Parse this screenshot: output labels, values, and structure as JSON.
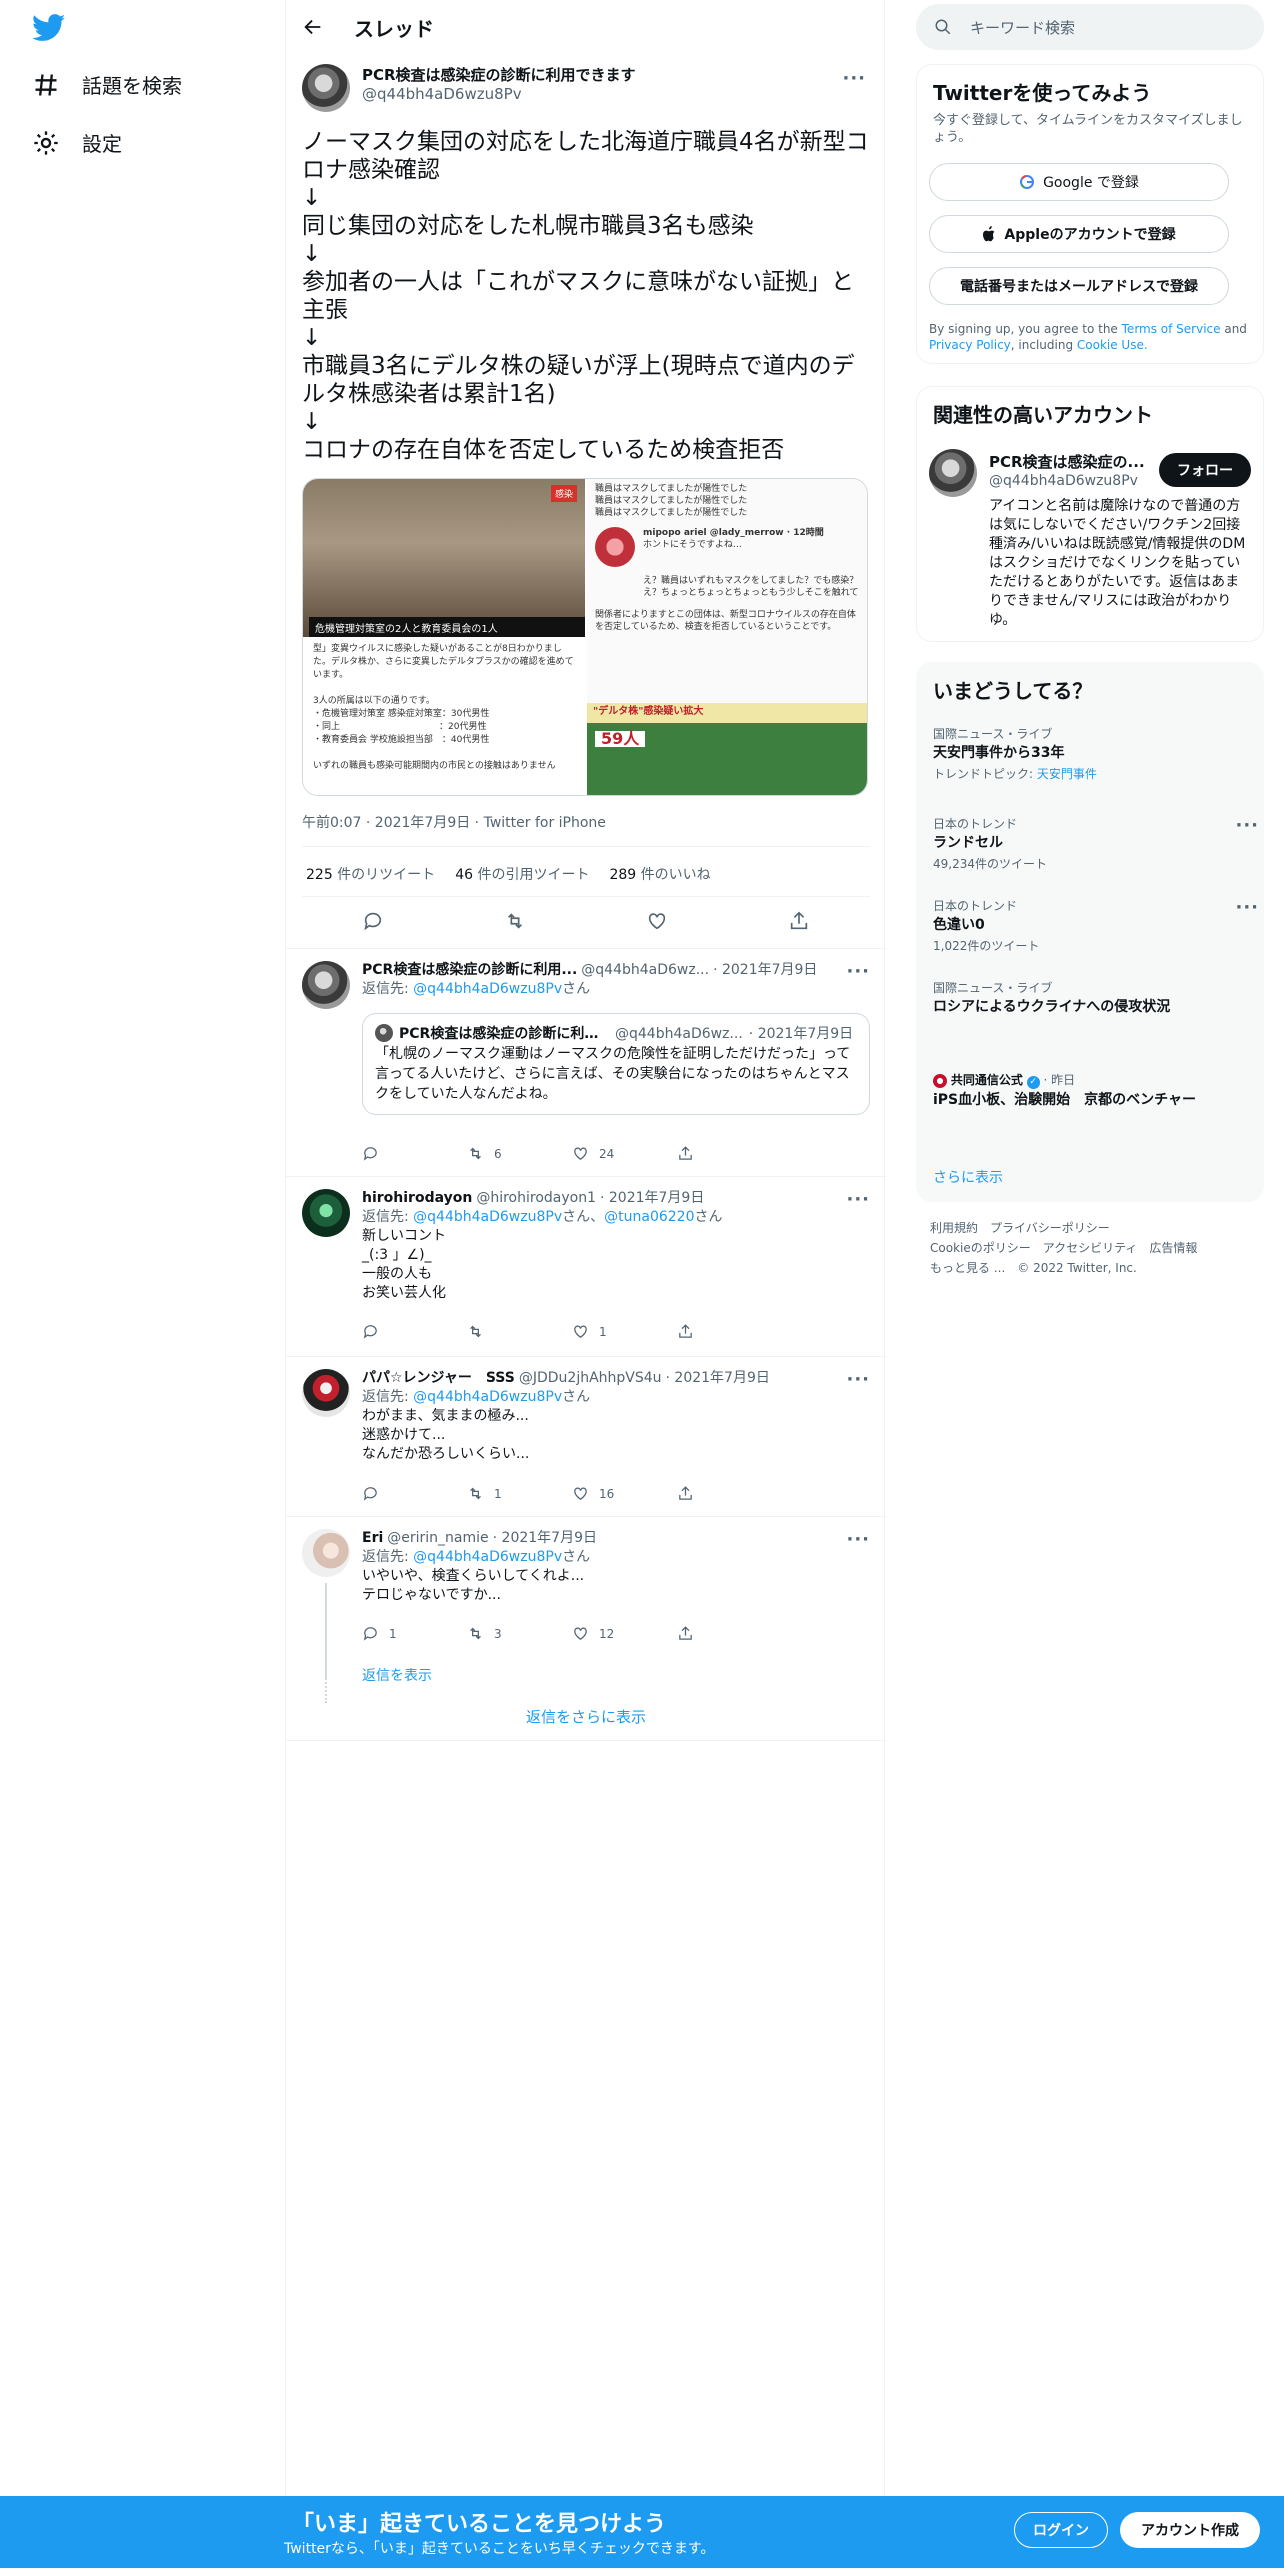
{
  "nav": {
    "explore_label": "話題を検索",
    "settings_label": "設定"
  },
  "header": {
    "title": "スレッド"
  },
  "tweet": {
    "author_name": "PCR検査は感染症の診断に利用できます",
    "author_handle": "@q44bh4aD6wzu8Pv",
    "text": "ノーマスク集団の対応をした北海道庁職員4名が新型コロナ感染確認\n↓\n同じ集団の対応をした札幌市職員3名も感染\n↓\n参加者の一人は「これがマスクに意味がない証拠」と主張\n↓\n市職員3名にデルタ株の疑いが浮上(現時点で道内のデルタ株感染者は累計1名)\n↓\nコロナの存在自体を否定しているため検査拒否",
    "media": {
      "img1_banner": "危機管理対策室の2人と教育委員会の1人",
      "img1_tag": "感染",
      "img1_body": "型」変異ウイルスに感染した疑いがあることが8日わかりました。デルタ株か、さらに変異したデルタプラスかの確認を進めています。\n\n3人の所属は以下の通りです。\n・危機管理対策室 感染症対策室：30代男性\n・同上　　　　　　　　　　　：20代男性\n・教育委員会 学校施設担当部　：40代男性\n\nいずれの職員も感染可能期間内の市民との接触はありません",
      "img2_top": "職員はマスクしてましたが陽性でした\n職員はマスクしてましたが陽性でした\n職員はマスクしてましたが陽性でした",
      "img2_user": "mipopo ariel @lady_merrow · 12時間",
      "img2_reply": "ホントにそうですよね…",
      "img2_mid": "え？職員はいずれもマスクをしてました？でも感染？え？ちょっとちょっとちょっともう少しそこを触れて",
      "img2_bottom": "関係者によりますとこの団体は、新型コロナウイルスの存在自体を否定しているため、検査を拒否しているということです。",
      "img2_chart_header": "\"デルタ株\"感染疑い拡大",
      "img2_chart_num": "59人"
    },
    "time": "午前0:07 · 2021年7月9日 · Twitter for iPhone",
    "retweets": "225",
    "retweets_label": "件のリツイート",
    "quotes": "46",
    "quotes_label": "件の引用ツイート",
    "likes": "289",
    "likes_label": "件のいいね"
  },
  "replies": [
    {
      "name": "PCR検査は感染症の診断に利用...",
      "handle": "@q44bh4aD6wz...",
      "date": "· 2021年7月9日",
      "reply_to_prefix": "返信先: ",
      "reply_to": "@q44bh4aD6wzu8Pv",
      "reply_to_suffix": "さん",
      "quote": {
        "name": "PCR検査は感染症の診断に利用...",
        "handle": "@q44bh4aD6wz...",
        "date": "· 2021年7月9日",
        "text": "「札幌のノーマスク運動はノーマスクの危険性を証明しただけだった」って言ってる人いたけど、さらに言えば、その実験台になったのはちゃんとマスクをしていた人なんだよね。"
      },
      "retweets": "6",
      "likes": "24"
    },
    {
      "name": "hirohirodayon",
      "handle": "@hirohirodayon1",
      "date": "· 2021年7月9日",
      "reply_to_prefix": "返信先: ",
      "reply_to": "@q44bh4aD6wzu8Pv",
      "reply_to_mid": "さん、",
      "reply_to2": "@tuna06220",
      "reply_to_suffix": "さん",
      "text": "新しいコント\n_(:3 」∠)_\n一般の人も\nお笑い芸人化",
      "retweets": "",
      "likes": "1"
    },
    {
      "name": "パパ☆レンジャー　SSS",
      "handle": "@JDDu2jhAhhpVS4u",
      "date": "· 2021年7月9日",
      "reply_to_prefix": "返信先: ",
      "reply_to": "@q44bh4aD6wzu8Pv",
      "reply_to_suffix": "さん",
      "text": "わがまま、気ままの極み...\n迷惑かけて...\nなんだか恐ろしいくらい...",
      "retweets": "1",
      "likes": "16"
    },
    {
      "name": "Eri",
      "handle": "@eririn_namie",
      "date": "· 2021年7月9日",
      "reply_to_prefix": "返信先: ",
      "reply_to": "@q44bh4aD6wzu8Pv",
      "reply_to_suffix": "さん",
      "text": "いやいや、検査くらいしてくれよ...\nテロじゃないですか...",
      "replies": "1",
      "retweets": "3",
      "likes": "12"
    }
  ],
  "show_replies": "返信を表示",
  "show_more_replies": "返信をさらに表示",
  "right": {
    "search_placeholder": "キーワード検索",
    "join": {
      "title": "Twitterを使ってみよう",
      "subtitle": "今すぐ登録して、タイムラインをカスタマイズしましょう。",
      "google": "Google で登録",
      "apple": "Appleのアカウントで登録",
      "phone": "電話番号またはメールアドレスで登録",
      "legal_prefix": "By signing up, you agree to the ",
      "tos": "Terms of Service",
      "and": " and ",
      "privacy": "Privacy Policy",
      "including": ", including ",
      "cookie": "Cookie Use."
    },
    "relevant": {
      "title": "関連性の高いアカウント",
      "name": "PCR検査は感染症の...",
      "handle": "@q44bh4aD6wzu8Pv",
      "follow": "フォロー",
      "bio": "アイコンと名前は魔除けなので普通の方は気にしないでください/ワクチン2回接種済み/いいねは既読感覚/情報提供のDMはスクショだけでなくリンクを貼っていただけるとありがたいです。返信はあまりできません/マリスには政治がわかりゆ。"
    },
    "trends": {
      "title": "いまどうしてる？",
      "items": [
        {
          "category": "国際ニュース・ライブ",
          "title": "天安門事件から33年",
          "sub_prefix": "トレンドトピック: ",
          "sub_link": "天安門事件"
        },
        {
          "category": "日本のトレンド",
          "title": "ランドセル",
          "sub": "49,234件のツイート"
        },
        {
          "category": "日本のトレンド",
          "title": "色違い0",
          "sub": "1,022件のツイート"
        },
        {
          "category": "国際ニュース・ライブ",
          "title": "ロシアによるウクライナへの侵攻状況"
        },
        {
          "publisher": "共同通信公式",
          "time": "· 昨日",
          "title": "iPS血小板、治験開始　京都のベンチャー"
        }
      ],
      "show_more": "さらに表示"
    },
    "footer": {
      "terms": "利用規約",
      "privacy": "プライバシーポリシー",
      "cookie": "Cookieのポリシー",
      "accessibility": "アクセシビリティ",
      "ads": "広告情報",
      "more": "もっと見る ...",
      "copyright": "© 2022 Twitter, Inc."
    }
  },
  "bottom": {
    "title": "「いま」起きていることを見つけよう",
    "subtitle": "Twitterなら、「いま」起きていることをいち早くチェックできます。",
    "login": "ログイン",
    "signup": "アカウント作成"
  },
  "colors": {
    "accent": "#1d9bf0",
    "text": "#0f1419",
    "muted": "#536471",
    "border": "#eff3f4"
  }
}
